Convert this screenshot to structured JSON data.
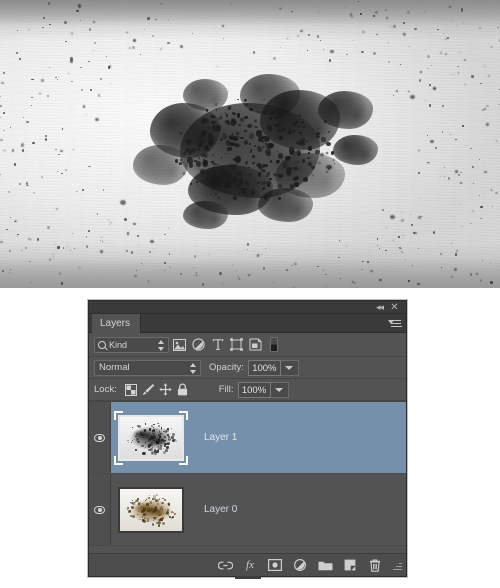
{
  "canvas": {
    "name": "document-canvas",
    "description": "Black ink splatter / grime texture on brushed light gray metal background"
  },
  "panel": {
    "title": "Layers",
    "titlebar": {
      "collapse_label": "◂◂",
      "close_label": "✕"
    },
    "menu_label": "Panel menu",
    "filter_row": {
      "kind_label": "Kind",
      "icons": [
        {
          "name": "filter-pixel-icon",
          "label": "Filter for pixel layers"
        },
        {
          "name": "filter-adjustment-icon",
          "label": "Filter for adjustment layers"
        },
        {
          "name": "filter-type-icon",
          "label": "Filter for type layers"
        },
        {
          "name": "filter-shape-icon",
          "label": "Filter for shape layers"
        },
        {
          "name": "filter-smart-object-icon",
          "label": "Filter for smart objects"
        }
      ],
      "toggle_label": "Turn layer filtering on/off"
    },
    "blend_row": {
      "blend_mode": "Normal",
      "opacity_label": "Opacity:",
      "opacity_value": "100%"
    },
    "lock_row": {
      "lock_label": "Lock:",
      "locks": [
        {
          "name": "lock-transparent-pixels-icon",
          "label": "Lock transparent pixels"
        },
        {
          "name": "lock-image-pixels-icon",
          "label": "Lock image pixels"
        },
        {
          "name": "lock-position-icon",
          "label": "Lock position"
        },
        {
          "name": "lock-all-icon",
          "label": "Lock all"
        }
      ],
      "fill_label": "Fill:",
      "fill_value": "100%"
    },
    "layers": [
      {
        "name": "Layer 1",
        "selected": true,
        "visible": true,
        "thumbnail": "grayscale-splatter-thumbnail"
      },
      {
        "name": "Layer 0",
        "selected": false,
        "visible": true,
        "thumbnail": "sepia-splatter-thumbnail"
      }
    ],
    "bottom_toolbar": [
      {
        "name": "link-layers-button",
        "label": "Link layers"
      },
      {
        "name": "layer-style-button",
        "label": "fx"
      },
      {
        "name": "add-layer-mask-button",
        "label": "Add layer mask"
      },
      {
        "name": "new-adjustment-layer-button",
        "label": "Create new fill or adjustment layer"
      },
      {
        "name": "new-group-button",
        "label": "Create a new group"
      },
      {
        "name": "new-layer-button",
        "label": "Create a new layer"
      },
      {
        "name": "delete-layer-button",
        "label": "Delete layer"
      }
    ]
  },
  "colors": {
    "panel_bg": "#535353",
    "panel_chrome": "#3a3a3a",
    "selected_layer": "#7590ab",
    "text": "#d2d2d2",
    "field_bg": "#4a4a4a"
  }
}
